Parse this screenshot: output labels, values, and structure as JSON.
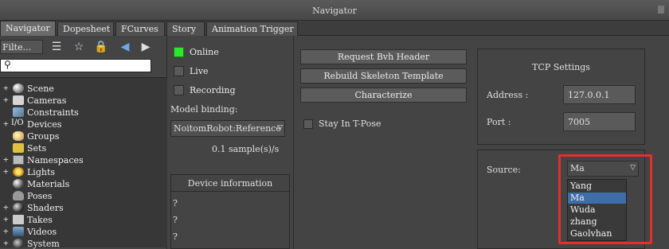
{
  "window": {
    "title": "Navigator"
  },
  "tabs": [
    {
      "label": "Navigator",
      "active": true
    },
    {
      "label": "Dopesheet"
    },
    {
      "label": "FCurves"
    },
    {
      "label": "Story"
    },
    {
      "label": "Animation Trigger"
    }
  ],
  "left": {
    "filter_label": "Filte...",
    "search_placeholder": "",
    "tree": [
      {
        "label": "Scene",
        "icon": "scene-icon",
        "expand": "+"
      },
      {
        "label": "Cameras",
        "icon": "camera-icon",
        "expand": "+"
      },
      {
        "label": "Constraints",
        "icon": "constraint-icon",
        "expand": ""
      },
      {
        "label": "Devices",
        "icon": "io-icon",
        "expand": "+",
        "prefix": "I/O"
      },
      {
        "label": "Groups",
        "icon": "groups-icon",
        "expand": ""
      },
      {
        "label": "Sets",
        "icon": "sets-icon",
        "expand": ""
      },
      {
        "label": "Namespaces",
        "icon": "namespace-icon",
        "expand": "+"
      },
      {
        "label": "Lights",
        "icon": "light-icon",
        "expand": "+"
      },
      {
        "label": "Materials",
        "icon": "material-icon",
        "expand": ""
      },
      {
        "label": "Poses",
        "icon": "pose-icon",
        "expand": ""
      },
      {
        "label": "Shaders",
        "icon": "shader-icon",
        "expand": "+"
      },
      {
        "label": "Takes",
        "icon": "take-icon",
        "expand": "+"
      },
      {
        "label": "Videos",
        "icon": "video-icon",
        "expand": "+"
      },
      {
        "label": "System",
        "icon": "system-icon",
        "expand": "+"
      }
    ]
  },
  "device": {
    "online": {
      "label": "Online",
      "checked": true
    },
    "live": {
      "label": "Live",
      "checked": false
    },
    "recording": {
      "label": "Recording",
      "checked": false
    },
    "model_binding_label": "Model binding:",
    "model_binding_value": "NoitomRobot:Reference",
    "sample_rate": "0.1 sample(s)/s",
    "device_info_header": "Device information",
    "device_info_lines": [
      "?",
      "?",
      "?"
    ]
  },
  "actions": {
    "request_bvh": "Request Bvh Header",
    "rebuild_skeleton": "Rebuild Skeleton Template",
    "characterize": "Characterize",
    "stay_tpose": "Stay In T-Pose"
  },
  "tcp": {
    "title": "TCP Settings",
    "address_label": "Address :",
    "address_value": "127.0.0.1",
    "port_label": "Port :",
    "port_value": "7005"
  },
  "source": {
    "label": "Source:",
    "selected": "Ma",
    "options": [
      "Yang",
      "Ma",
      "Wuda",
      "zhang",
      "Gaolvhan"
    ],
    "highlight_color": "#e0312b",
    "selection_color": "#3e6ea8"
  }
}
